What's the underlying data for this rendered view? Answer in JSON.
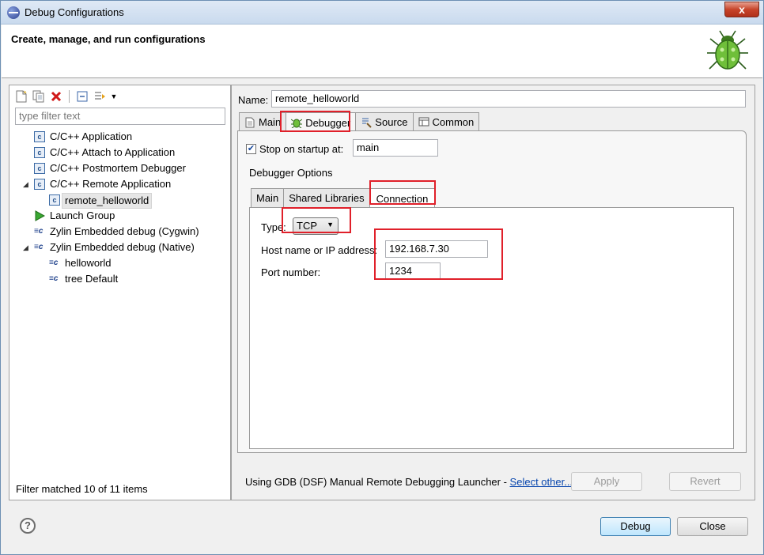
{
  "window": {
    "title": "Debug Configurations",
    "close_glyph": "x"
  },
  "header": {
    "title": "Create, manage, and run configurations",
    "bug_icon": "bug-icon"
  },
  "left": {
    "toolbar": {
      "icons": [
        "new-config-icon",
        "duplicate-icon",
        "delete-icon",
        "collapse-all-icon",
        "filter-icon",
        "dropdown-icon"
      ]
    },
    "filter_placeholder": "type filter text",
    "tree": [
      {
        "label": "C/C++ Application",
        "icon": "c-config-icon"
      },
      {
        "label": "C/C++ Attach to Application",
        "icon": "c-config-icon"
      },
      {
        "label": "C/C++ Postmortem Debugger",
        "icon": "c-config-icon"
      },
      {
        "label": "C/C++ Remote Application",
        "icon": "c-config-icon",
        "expanded": true
      },
      {
        "label": "remote_helloworld",
        "icon": "c-config-icon",
        "selected": true
      },
      {
        "label": "Launch Group",
        "icon": "launch-group-icon"
      },
      {
        "label": "Zylin Embedded debug (Cygwin)",
        "icon": "zylin-icon"
      },
      {
        "label": "Zylin Embedded debug (Native)",
        "icon": "zylin-icon",
        "expanded": true
      },
      {
        "label": "helloworld",
        "icon": "zylin-icon"
      },
      {
        "label": "tree Default",
        "icon": "zylin-icon"
      }
    ],
    "filter_status": "Filter matched 10 of 11 items"
  },
  "right": {
    "name_label": "Name:",
    "name_value": "remote_helloworld",
    "tabs": [
      {
        "label": "Main",
        "icon": "main-tab-icon"
      },
      {
        "label": "Debugger",
        "icon": "debugger-tab-icon",
        "active": true
      },
      {
        "label": "Source",
        "icon": "source-tab-icon"
      },
      {
        "label": "Common",
        "icon": "common-tab-icon"
      }
    ],
    "stop_on_startup_label": "Stop on startup at:",
    "stop_on_startup_checked": true,
    "stop_on_startup_value": "main",
    "debugger_options_label": "Debugger Options",
    "inner_tabs": [
      {
        "label": "Main"
      },
      {
        "label": "Shared Libraries"
      },
      {
        "label": "Connection",
        "active": true
      }
    ],
    "connection": {
      "type_label": "Type:",
      "type_value": "TCP",
      "host_label": "Host name or IP address:",
      "host_value": "192.168.7.30",
      "port_label": "Port number:",
      "port_value": "1234"
    },
    "launcher_text": "Using GDB (DSF) Manual Remote Debugging Launcher - ",
    "launcher_link": "Select other...",
    "apply_label": "Apply",
    "revert_label": "Revert"
  },
  "footer": {
    "help_glyph": "?",
    "debug_label": "Debug",
    "close_label": "Close"
  },
  "colors": {
    "highlight": "#e0202a",
    "link": "#0645ad",
    "title_bar": "#c9daee"
  }
}
